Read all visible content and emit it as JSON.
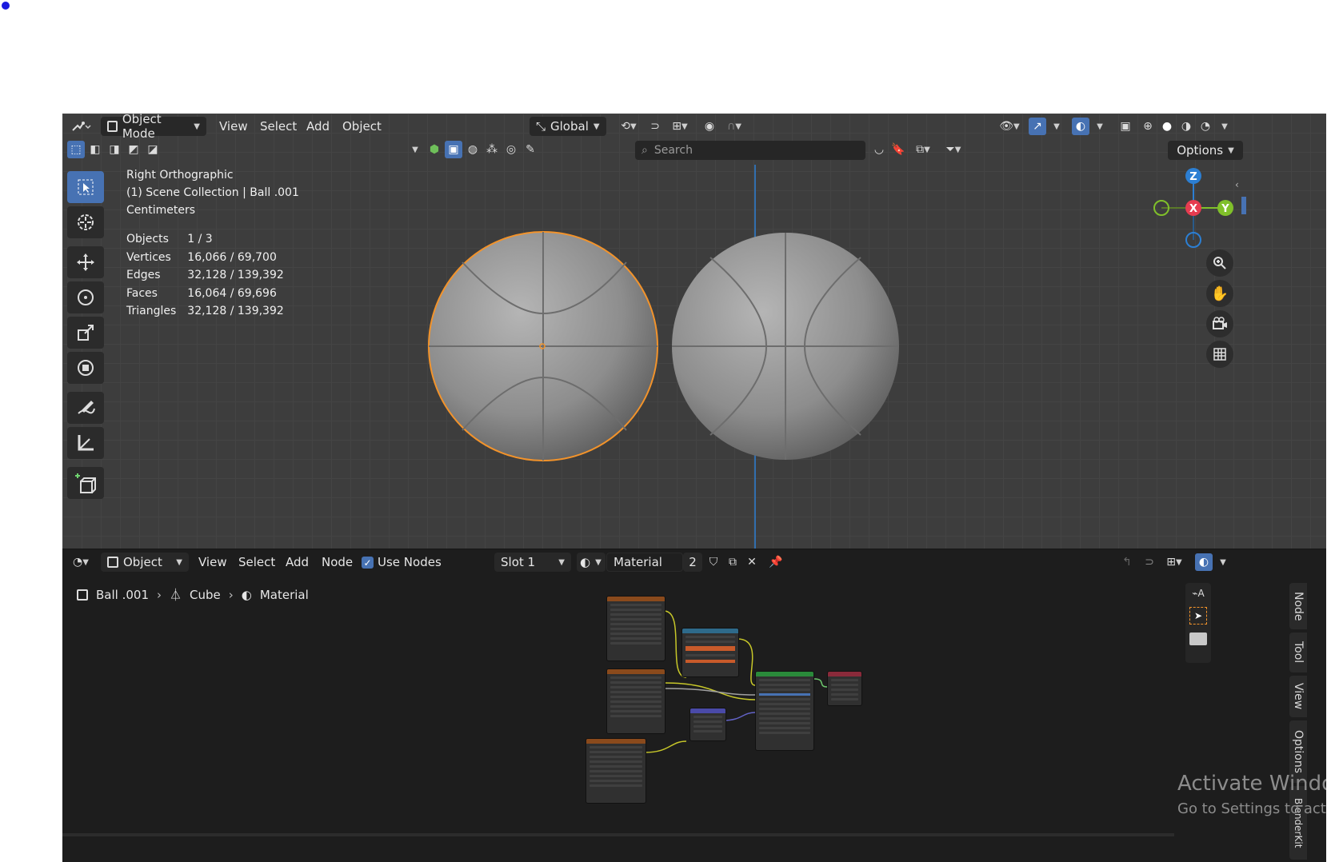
{
  "viewport_header": {
    "mode": "Object Mode",
    "menus": [
      "View",
      "Select",
      "Add",
      "Object"
    ],
    "transform_orientation": "Global",
    "search_placeholder": "Search",
    "options_label": "Options"
  },
  "viewport_overlay": {
    "view_name": "Right Orthographic",
    "collection": "(1) Scene Collection | Ball .001",
    "units": "Centimeters",
    "stats": [
      {
        "label": "Objects",
        "value": "1 / 3"
      },
      {
        "label": "Vertices",
        "value": "16,066 / 69,700"
      },
      {
        "label": "Edges",
        "value": "32,128 / 139,392"
      },
      {
        "label": "Faces",
        "value": "16,064 / 69,696"
      },
      {
        "label": "Triangles",
        "value": "32,128 / 139,392"
      }
    ]
  },
  "gizmo": {
    "z": "Z",
    "x": "X",
    "y": "Y"
  },
  "node_header": {
    "type": "Object",
    "menus": [
      "View",
      "Select",
      "Add",
      "Node"
    ],
    "use_nodes_label": "Use Nodes",
    "use_nodes_checked": true,
    "slot": "Slot 1",
    "material_name": "Material",
    "user_count": "2"
  },
  "breadcrumb": {
    "object": "Ball .001",
    "mesh": "Cube",
    "material": "Material"
  },
  "side_tabs": [
    "Node",
    "Tool",
    "View",
    "Options",
    "BlenderKit"
  ],
  "watermark": {
    "line1": "Activate Windows",
    "line2": "Go to Settings to activate Windows."
  },
  "colors": {
    "accent": "#4772b3",
    "selection": "#f2932b",
    "axis_x": "#e63c50",
    "axis_y": "#80c02a",
    "axis_z": "#2c7fd3"
  }
}
